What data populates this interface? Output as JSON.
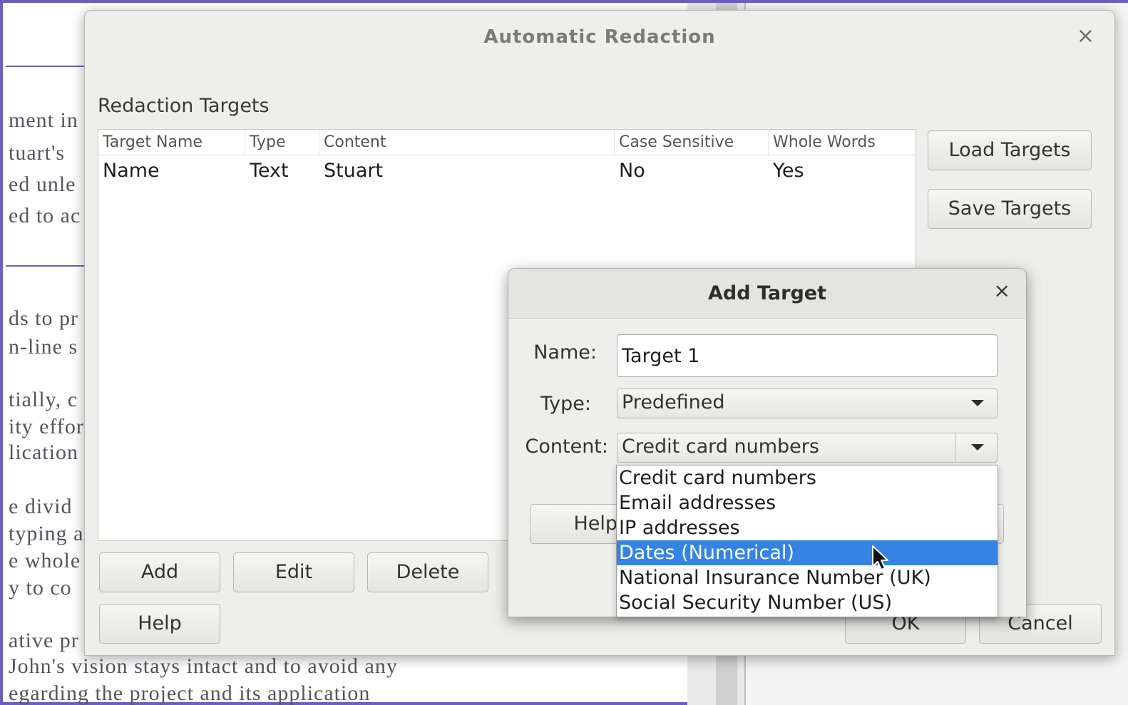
{
  "document": {
    "fragments": [
      "ment in",
      "tuart's",
      "ed unle",
      "ed to ac",
      "ds to pr",
      "n-line s",
      "tially, c",
      "ity effor",
      "lication",
      "e divid",
      "typing a",
      "e whole",
      "y to co",
      "ative pr"
    ],
    "bottom_line_1": "John's vision stays intact and to avoid any",
    "bottom_line_2": "egarding the project and its application"
  },
  "main_dialog": {
    "title": "Automatic Redaction",
    "close_glyph": "×",
    "section_label": "Redaction Targets",
    "columns": [
      "Target Name",
      "Type",
      "Content",
      "Case Sensitive",
      "Whole Words"
    ],
    "rows": [
      {
        "name": "Name",
        "type": "Text",
        "content": "Stuart",
        "case_sensitive": "No",
        "whole_words": "Yes"
      }
    ],
    "buttons": {
      "load_targets": "Load Targets",
      "save_targets": "Save Targets",
      "add": "Add",
      "edit": "Edit",
      "delete": "Delete",
      "help": "Help",
      "ok": "OK",
      "cancel": "Cancel"
    }
  },
  "add_target_dialog": {
    "title": "Add Target",
    "close_glyph": "×",
    "name_label": "Name:",
    "name_value": "Target 1",
    "type_label": "Type:",
    "type_value": "Predefined",
    "content_label": "Content:",
    "content_value": "Credit card numbers",
    "help_button": "Help",
    "dropdown_options": [
      "Credit card numbers",
      "Email addresses",
      "IP addresses",
      "Dates (Numerical)",
      "National Insurance Number (UK)",
      "Social Security Number (US)"
    ],
    "highlighted_option": "Dates (Numerical)"
  },
  "colors": {
    "selection": "#3584e4",
    "document_border": "#6a5fc0",
    "dialog_bg": "#eeeeec"
  }
}
